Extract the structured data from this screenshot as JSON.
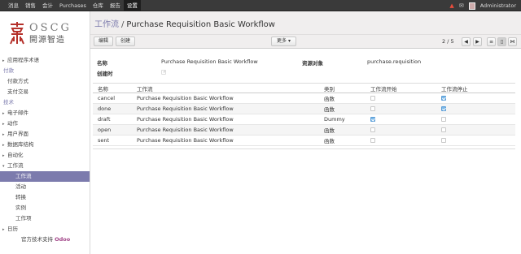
{
  "topbar": {
    "menu": [
      "消息",
      "销售",
      "会计",
      "Purchases",
      "仓库",
      "报告",
      "设置"
    ],
    "active_index": 6,
    "user": "Administrator",
    "warning_icon": "warning-icon",
    "message_icon": "chat-bubble-icon"
  },
  "logo": {
    "en": "OSCG",
    "cn": "開源智造"
  },
  "sidebar": {
    "items": [
      {
        "label": "应用程序术语",
        "kind": "collapsed"
      },
      {
        "label": "付款",
        "kind": "section"
      },
      {
        "label": "付款方式",
        "kind": "sub"
      },
      {
        "label": "支付交易",
        "kind": "sub"
      },
      {
        "label": "技术",
        "kind": "section"
      },
      {
        "label": "电子邮件",
        "kind": "collapsed"
      },
      {
        "label": "动作",
        "kind": "collapsed"
      },
      {
        "label": "用户界面",
        "kind": "collapsed"
      },
      {
        "label": "数据库结构",
        "kind": "collapsed"
      },
      {
        "label": "自动化",
        "kind": "collapsed"
      },
      {
        "label": "工作流",
        "kind": "expanded"
      },
      {
        "label": "工作流",
        "kind": "sub2",
        "selected": true
      },
      {
        "label": "活动",
        "kind": "sub2"
      },
      {
        "label": "转换",
        "kind": "sub2"
      },
      {
        "label": "实例",
        "kind": "sub2"
      },
      {
        "label": "工作项",
        "kind": "sub2"
      },
      {
        "label": "日历",
        "kind": "collapsed"
      }
    ],
    "footer_text": "官方技术支持",
    "footer_brand": "Odoo"
  },
  "breadcrumb": {
    "parent": "工作流",
    "separator": "/",
    "current": "Purchase Requisition Basic Workflow"
  },
  "toolbar": {
    "edit_label": "编辑",
    "create_label": "创建",
    "more_label": "更多 ▾"
  },
  "pager": {
    "text": "2 / 5"
  },
  "form": {
    "name_label": "名称",
    "name_value": "Purchase Requisition Basic Workflow",
    "resource_label": "资源对象",
    "resource_value": "purchase.requisition",
    "on_create_label": "创建时",
    "on_create_checked": true
  },
  "table": {
    "headers": [
      "名称",
      "工作流",
      "类别",
      "工作流开始",
      "工作流停止"
    ],
    "rows": [
      {
        "name": "cancel",
        "workflow": "Purchase Requisition Basic Workflow",
        "kind": "函数",
        "start": false,
        "stop": true
      },
      {
        "name": "done",
        "workflow": "Purchase Requisition Basic Workflow",
        "kind": "函数",
        "start": false,
        "stop": true
      },
      {
        "name": "draft",
        "workflow": "Purchase Requisition Basic Workflow",
        "kind": "Dummy",
        "start": true,
        "stop": false
      },
      {
        "name": "open",
        "workflow": "Purchase Requisition Basic Workflow",
        "kind": "函数",
        "start": false,
        "stop": false
      },
      {
        "name": "sent",
        "workflow": "Purchase Requisition Basic Workflow",
        "kind": "函数",
        "start": false,
        "stop": false
      }
    ]
  },
  "colors": {
    "accent": "#7c7bad",
    "topbar": "#3a3a3a",
    "brand": "#a24689"
  }
}
